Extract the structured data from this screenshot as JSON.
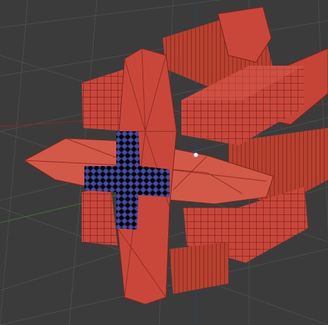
{
  "viewport": {
    "background": "#3b3b3b",
    "grid_color": "#4d4d4d",
    "x_axis_color": "#8a2a2a",
    "y_axis_color": "#3a7a2a",
    "z_axis_color": "#2b3f7a"
  },
  "model": {
    "body_color": "#c9473a",
    "body_dark": "#8f2d24",
    "body_light": "#e07060",
    "highlight_color": "#3b4fa8",
    "pivot_color": "#ffffff"
  }
}
